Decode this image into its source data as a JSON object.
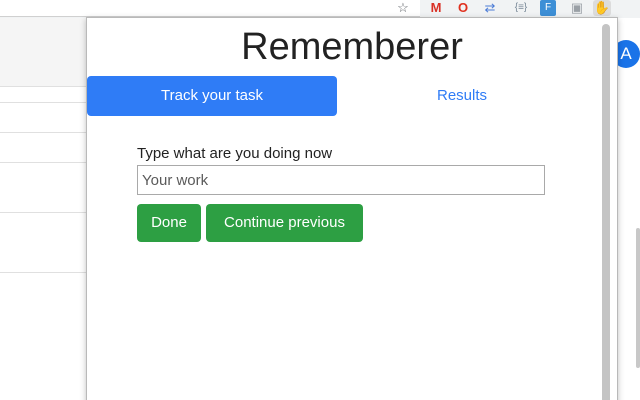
{
  "browser": {
    "toolbar_icons": [
      "star-icon",
      "gmail-icon",
      "opera-icon",
      "translate-icon",
      "json-icon",
      "f-extension-icon",
      "extension-icon",
      "hand-icon"
    ]
  },
  "background": {
    "avatar_letter": "A",
    "accent": "#1a73e8"
  },
  "popup": {
    "title": "Rememberer",
    "tabs": [
      {
        "label": "Track your task",
        "active": true
      },
      {
        "label": "Results",
        "active": false
      }
    ],
    "form": {
      "label": "Type what are you doing now",
      "input_placeholder": "Your work",
      "input_value": ""
    },
    "buttons": {
      "done": "Done",
      "continue": "Continue previous"
    },
    "colors": {
      "tab_active": "#2f7cf6",
      "button": "#2d9f43"
    }
  }
}
